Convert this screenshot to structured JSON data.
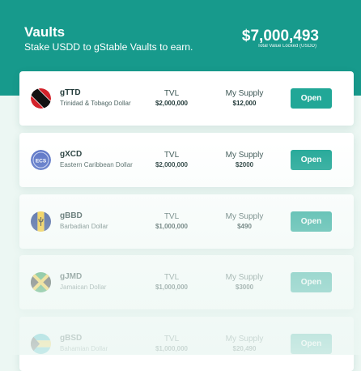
{
  "header": {
    "title": "Vaults",
    "subtitle": "Stake USDD to gStable Vaults to earn.",
    "total_value": "$7,000,493",
    "total_label": "Total Value Locked (USDD)",
    "background_color": "#179a8c"
  },
  "vaults": [
    {
      "name": "gTTD",
      "description": "Trinidad & Tobago Dollar",
      "tvl_label": "TVL",
      "tvl": "$2,000,000",
      "supply_label": "My Supply",
      "supply": "$12,000",
      "button": "Open",
      "flag_icon": "trinidad-tobago-flag-icon"
    },
    {
      "name": "gXCD",
      "description": "Eastern Caribbean Dollar",
      "tvl_label": "TVL",
      "tvl": "$2,000,000",
      "supply_label": "My Supply",
      "supply": "$2000",
      "button": "Open",
      "flag_icon": "ecs-badge-icon",
      "flag_text": "ECS"
    },
    {
      "name": "gBBD",
      "description": "Barbadian Dollar",
      "tvl_label": "TVL",
      "tvl": "$1,000,000",
      "supply_label": "My Supply",
      "supply": "$490",
      "button": "Open",
      "flag_icon": "barbados-flag-icon"
    },
    {
      "name": "gJMD",
      "description": "Jamaican Dollar",
      "tvl_label": "TVL",
      "tvl": "$1,000,000",
      "supply_label": "My Supply",
      "supply": "$3000",
      "button": "Open",
      "flag_icon": "jamaica-flag-icon"
    },
    {
      "name": "gBSD",
      "description": "Bahamian Dollar",
      "tvl_label": "TVL",
      "tvl": "$1,000,000",
      "supply_label": "My Supply",
      "supply": "$20,490",
      "button": "Open",
      "flag_icon": "bahamas-flag-icon"
    }
  ],
  "colors": {
    "accent": "#21a797",
    "page_background": "#ecf7f3"
  }
}
